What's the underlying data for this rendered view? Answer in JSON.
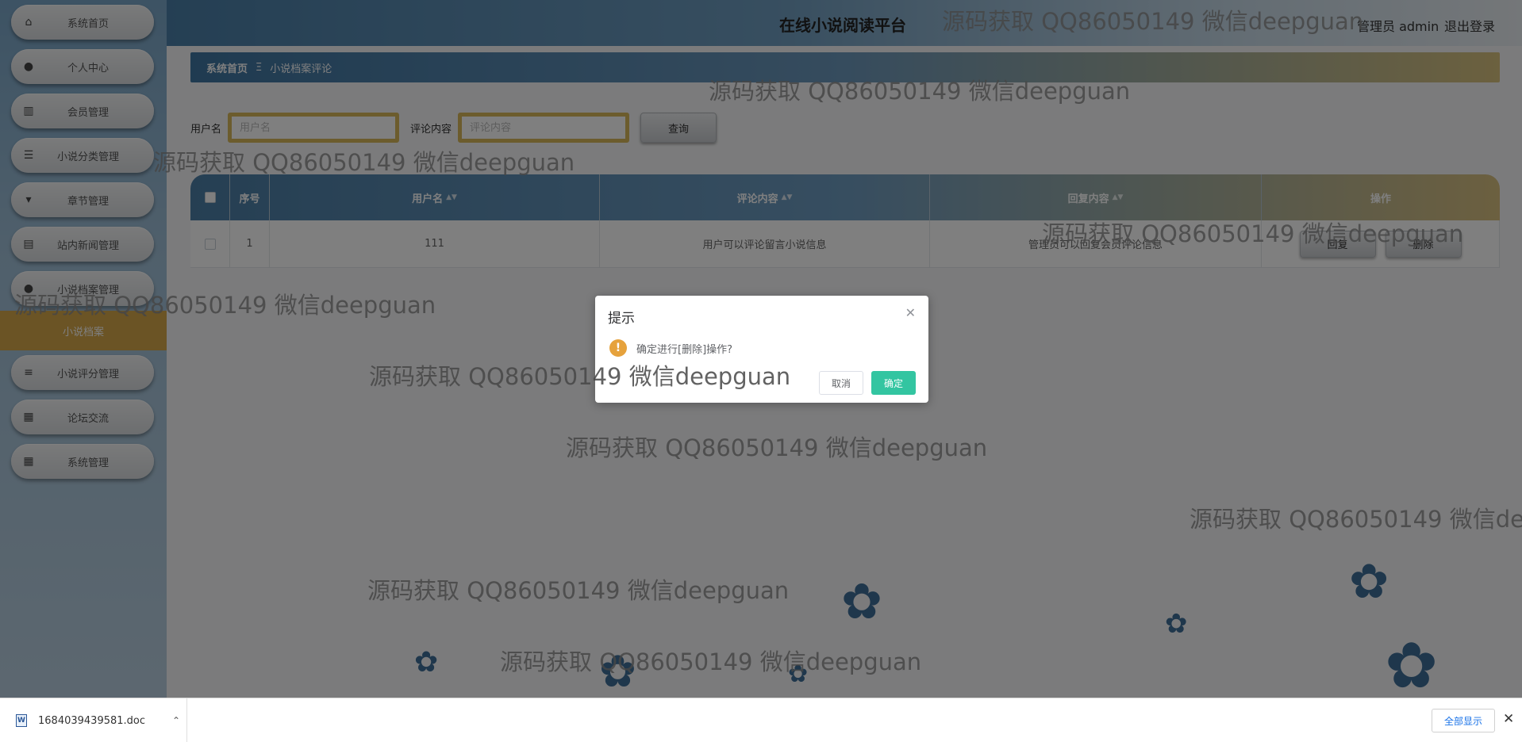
{
  "sidebar": {
    "items": [
      {
        "label": "系统首页",
        "icon": "home-icon",
        "glyph": "⌂"
      },
      {
        "label": "个人中心",
        "icon": "user-icon",
        "glyph": "●"
      },
      {
        "label": "会员管理",
        "icon": "chart-icon",
        "glyph": "▥"
      },
      {
        "label": "小说分类管理",
        "icon": "sliders-icon",
        "glyph": "☰"
      },
      {
        "label": "章节管理",
        "icon": "pin-icon",
        "glyph": "▾"
      },
      {
        "label": "站内新闻管理",
        "icon": "briefcase-icon",
        "glyph": "▤"
      },
      {
        "label": "小说档案管理",
        "icon": "person-icon",
        "glyph": "●"
      },
      {
        "label": "小说评分管理",
        "icon": "list-icon",
        "glyph": "≡"
      },
      {
        "label": "论坛交流",
        "icon": "grid-icon",
        "glyph": "▦"
      },
      {
        "label": "系统管理",
        "icon": "grid-icon",
        "glyph": "▦"
      }
    ],
    "submenu_label": "小说档案"
  },
  "header": {
    "title": "在线小说阅读平台",
    "admin": "管理员 admin",
    "logout": "退出登录"
  },
  "breadcrumb": {
    "home": "系统首页",
    "separator": "Ξ",
    "current": "小说档案评论"
  },
  "search": {
    "username_label": "用户名",
    "username_placeholder": "用户名",
    "content_label": "评论内容",
    "content_placeholder": "评论内容",
    "query_button": "查询"
  },
  "table": {
    "headers": [
      "序号",
      "用户名",
      "评论内容",
      "回复内容",
      "操作"
    ],
    "rows": [
      {
        "index": "1",
        "username": "111",
        "content": "用户可以评论留言小说信息",
        "reply": "管理员可以回复会员评论信息"
      }
    ],
    "reply_button": "回复",
    "delete_button": "删除"
  },
  "dialog": {
    "title": "提示",
    "message": "确定进行[删除]操作?",
    "cancel": "取消",
    "confirm": "确定"
  },
  "watermark_text": "源码获取 QQ86050149 微信deepguan",
  "download_bar": {
    "file_name": "1684039439581.doc",
    "show_all": "全部显示"
  }
}
